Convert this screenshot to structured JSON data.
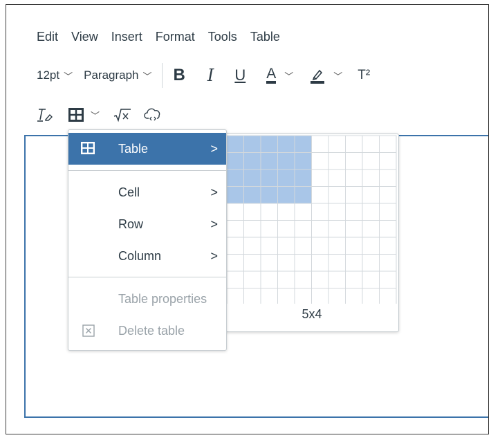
{
  "menubar": {
    "items": [
      "Edit",
      "View",
      "Insert",
      "Format",
      "Tools",
      "Table"
    ]
  },
  "toolbar": {
    "font_size": "12pt",
    "block_format": "Paragraph",
    "bold_label": "B",
    "italic_label": "I",
    "underline_label": "U",
    "text_color_label": "A",
    "superscript_label": "T²"
  },
  "table_menu": {
    "items": [
      {
        "label": "Table",
        "arrow": ">",
        "icon": "table-icon",
        "active": true
      },
      {
        "label": "Cell",
        "arrow": ">"
      },
      {
        "label": "Row",
        "arrow": ">"
      },
      {
        "label": "Column",
        "arrow": ">"
      },
      {
        "label": "Table properties",
        "disabled": true
      },
      {
        "label": "Delete table",
        "icon": "delete-table-icon",
        "disabled": true
      }
    ]
  },
  "grid_picker": {
    "columns": 10,
    "rows": 10,
    "selected_columns": 5,
    "selected_rows": 4,
    "label": "5x4",
    "highlight_color": "#a9c6e8",
    "border_color": "#d3d8dc"
  },
  "colors": {
    "accent": "#3c73aa",
    "text": "#2d3b45",
    "disabled": "#9aa3a9"
  }
}
